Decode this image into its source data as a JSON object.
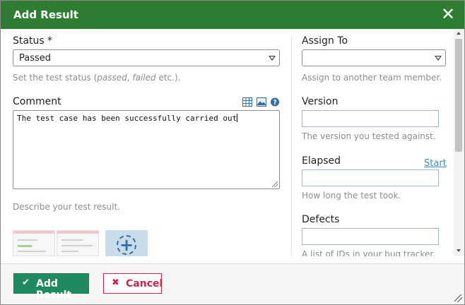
{
  "dialog": {
    "title": "Add Result",
    "close_icon": "close-icon"
  },
  "status": {
    "label": "Status *",
    "value": "Passed",
    "help_prefix": "Set the test status (",
    "help_passed": "passed",
    "help_sep": ", ",
    "help_failed": "failed",
    "help_suffix": " etc.)."
  },
  "comment": {
    "label": "Comment",
    "value": "The test case has been successfully carried out",
    "help": "Describe your test result.",
    "toolbar_icons": [
      "table-icon",
      "image-icon",
      "help-icon"
    ]
  },
  "assign_to": {
    "label": "Assign To",
    "value": "",
    "help": "Assign to another team member."
  },
  "version": {
    "label": "Version",
    "value": "",
    "help": "The version you tested against."
  },
  "elapsed": {
    "label": "Elapsed",
    "link": "Start",
    "value": "",
    "help": "How long the test took."
  },
  "defects": {
    "label": "Defects",
    "value": "",
    "help": "A list of IDs in your bug tracker."
  },
  "attachments": {
    "thumbnails": [
      "screenshot-thumbnail",
      "screenshot-thumbnail"
    ],
    "add_icon": "add-attachment-icon"
  },
  "footer": {
    "add_label": "Add Result",
    "cancel_label": "Cancel"
  },
  "colors": {
    "header": "#2e7d32",
    "primary_button": "#1f8a5f",
    "cancel": "#c8254a",
    "link": "#3f88c5"
  }
}
